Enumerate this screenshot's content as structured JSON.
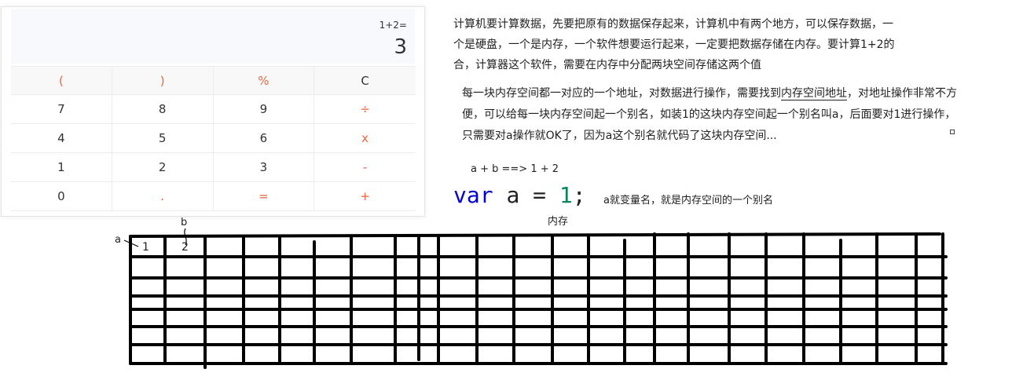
{
  "calculator": {
    "expression": "1+2=",
    "result": "3",
    "keys": [
      [
        "(",
        ")",
        "%",
        "C"
      ],
      [
        "7",
        "8",
        "9",
        "÷"
      ],
      [
        "4",
        "5",
        "6",
        "x"
      ],
      [
        "1",
        "2",
        "3",
        "-"
      ],
      [
        "0",
        ".",
        "=",
        "+"
      ]
    ],
    "accent_color": "#e8663c"
  },
  "text": {
    "paragraph1": "计算机要计算数据，先要把原有的数据保存起来，计算机中有两个地方，可以保存数据，一个是硬盘，一个是内存，一个软件想要运行起来，一定要把数据存储在内存。要计算1+2的合，计算器这个软件，需要在内存中分配两块空间存储这两个值",
    "paragraph2_before": "每一块内存空间都一对应的一个地址，对数据进行操作，需要找到",
    "paragraph2_underlined": "内存空间地址",
    "paragraph2_after": "，对地址操作非常不方便，可以给每一块内存空间起一个别名，如装1的这块内存空间起一个别名叫a，后面要对1进行操作，只需要对a操作就OK了，因为a这个别名就代码了这块内存空间...",
    "formula": "a + b  ==> 1 + 2",
    "code_keyword": "var",
    "code_identifier": "a",
    "code_operator": "=",
    "code_number": "1",
    "code_terminator": ";",
    "code_note": "a就变量名，就是内存空间的一个别名",
    "memory_title": "内存"
  },
  "memory": {
    "label_a": "a",
    "label_b": "b",
    "cell1": "1",
    "cell2": "2"
  }
}
